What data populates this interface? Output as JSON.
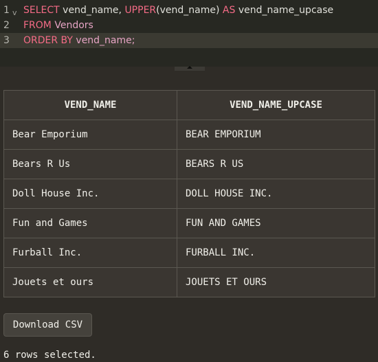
{
  "editor": {
    "lines": [
      {
        "number": "1",
        "t1": "SELECT",
        "t2": " vend_name, ",
        "t3": "UPPER",
        "t4": "(vend_name) ",
        "t5": "AS",
        "t6": " vend_name_upcase"
      },
      {
        "number": "2",
        "t1": "FROM",
        "t2": " Vendors"
      },
      {
        "number": "3",
        "t1": "ORDER BY",
        "t2": " vend_name;"
      }
    ],
    "fold_glyph": "v"
  },
  "results": {
    "columns": [
      "VEND_NAME",
      "VEND_NAME_UPCASE"
    ],
    "rows": [
      [
        "Bear Emporium",
        "BEAR EMPORIUM"
      ],
      [
        "Bears R Us",
        "BEARS R US"
      ],
      [
        "Doll House Inc.",
        "DOLL HOUSE INC."
      ],
      [
        "Fun and Games",
        "FUN AND GAMES"
      ],
      [
        "Furball Inc.",
        "FURBALL INC."
      ],
      [
        "Jouets et ours",
        "JOUETS ET OURS"
      ]
    ]
  },
  "download_button": {
    "label": "Download CSV"
  },
  "status": {
    "text": "6 rows selected."
  },
  "colors": {
    "keyword": "#f46b86",
    "editor_bg": "#272822",
    "panel_bg": "#2f2c27",
    "table_bg": "#3a3631"
  }
}
